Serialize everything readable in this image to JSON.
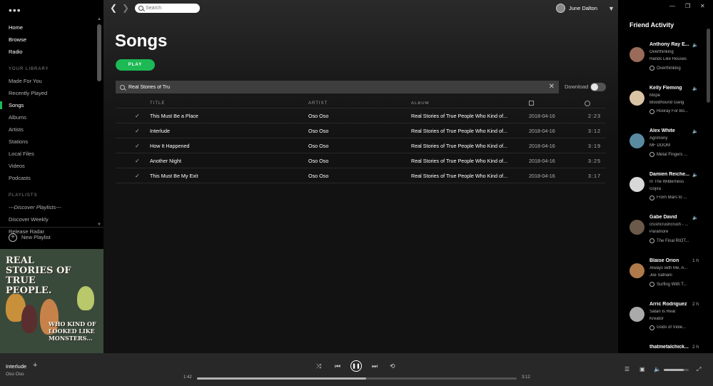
{
  "sidebar": {
    "menu_icon": "more-dots-icon",
    "nav": [
      "Home",
      "Browse",
      "Radio"
    ],
    "library_label": "YOUR LIBRARY",
    "library": [
      "Made For You",
      "Recently Played",
      "Songs",
      "Albums",
      "Artists",
      "Stations",
      "Local Files",
      "Videos",
      "Podcasts"
    ],
    "active_item": "Songs",
    "playlists_label": "PLAYLISTS",
    "playlists": [
      "---Discover Playlists---",
      "Discover Weekly",
      "Release Radar"
    ],
    "new_playlist": "New Playlist"
  },
  "album_art": {
    "title": "REAL STORIES OF TRUE PEOPLE.",
    "subtitle": "WHO KIND OF LOOKED LIKE MONSTERS..."
  },
  "topbar": {
    "search_placeholder": "Search",
    "user_name": "June Dalton"
  },
  "page": {
    "title": "Songs",
    "play_label": "PLAY",
    "filter_value": "Real Stories of Tru",
    "download_label": "Download",
    "download_on": false
  },
  "table": {
    "headers": {
      "title": "TITLE",
      "artist": "ARTIST",
      "album": "ALBUM"
    },
    "rows": [
      {
        "title": "This Must Be a Place",
        "artist": "Oso Oso",
        "album": "Real Stories of True People Who Kind of...",
        "date": "2018-04-16",
        "duration": "2:23"
      },
      {
        "title": "Interlude",
        "artist": "Oso Oso",
        "album": "Real Stories of True People Who Kind of...",
        "date": "2018-04-16",
        "duration": "3:12"
      },
      {
        "title": "How It Happened",
        "artist": "Oso Oso",
        "album": "Real Stories of True People Who Kind of...",
        "date": "2018-04-16",
        "duration": "3:19"
      },
      {
        "title": "Another Night",
        "artist": "Oso Oso",
        "album": "Real Stories of True People Who Kind of...",
        "date": "2018-04-16",
        "duration": "3:25"
      },
      {
        "title": "This Must Be My Exit",
        "artist": "Oso Oso",
        "album": "Real Stories of True People Who Kind of...",
        "date": "2018-04-16",
        "duration": "3:17"
      }
    ]
  },
  "friends": {
    "title": "Friend Activity",
    "list": [
      {
        "name": "Anthony Ray E...",
        "status": "speaker",
        "track": "Overthinking",
        "artist": "Hands Like Houses",
        "context": "Overthinking",
        "color": "#9a6b5a"
      },
      {
        "name": "Kelly Fleming",
        "status": "speaker",
        "track": "Mope",
        "artist": "Bloodhound Gang",
        "context": "Hooray For Bo...",
        "color": "#d9c3a5"
      },
      {
        "name": "Alex White",
        "status": "speaker",
        "track": "Agrimony",
        "artist": "MF DOOM",
        "context": "Metal Fingers ...",
        "color": "#5a8aa0"
      },
      {
        "name": "Damien Reiche...",
        "status": "speaker",
        "track": "In The Wilderness",
        "artist": "Gojira",
        "context": "From Mars to ...",
        "color": "#d8d8d8"
      },
      {
        "name": "Gabe David",
        "status": "speaker",
        "track": "crushcrushcrush - ...",
        "artist": "Paramore",
        "context": "The Final RIOT...",
        "color": "#6b5a4a"
      },
      {
        "name": "Blaise Orion",
        "status": "1 h",
        "track": "Always with Me, A...",
        "artist": "Joe Satriani",
        "context": "Surfing With T...",
        "color": "#b07a4a"
      },
      {
        "name": "Arric Rodriguez",
        "status": "2 h",
        "track": "Satan Is Real",
        "artist": "Kreator",
        "context": "Gods of Viole...",
        "color": "#aaaaaa"
      },
      {
        "name": "thatmetalchick...",
        "status": "2 h",
        "track": "",
        "artist": "",
        "context": "",
        "color": "#000000"
      }
    ]
  },
  "player": {
    "track": "Interlude",
    "artist": "Oso Oso",
    "elapsed": "1:42",
    "total": "3:12",
    "progress_fraction": 0.53,
    "volume_fraction": 0.8
  },
  "colors": {
    "accent": "#1db954",
    "background": "#121212",
    "sidebar": "#000000",
    "player": "#282828"
  }
}
